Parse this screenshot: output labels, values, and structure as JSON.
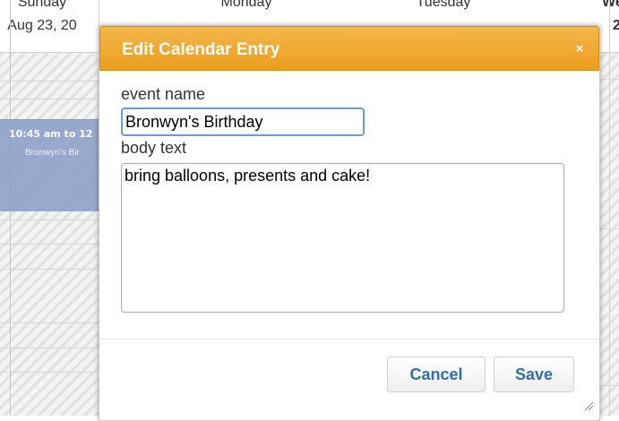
{
  "calendar": {
    "days": [
      {
        "name": "Sunday",
        "date": "Aug 23, 20"
      },
      {
        "name": "Monday",
        "date": ""
      },
      {
        "name": "Tuesday",
        "date": ""
      },
      {
        "name": "Wedn",
        "date": "2"
      }
    ],
    "event": {
      "time": "10:45 am to 12",
      "title": "Bronwyn's Bir"
    }
  },
  "dialog": {
    "title": "Edit Calendar Entry",
    "close_icon": "×",
    "event_name_label": "event name",
    "event_name_value": "Bronwyn's Birthday",
    "body_label": "body text",
    "body_value": "bring balloons, presents and cake!",
    "cancel_label": "Cancel",
    "save_label": "Save",
    "colors": {
      "titlebar": "#ec9d1f",
      "button_text": "#2f6fad",
      "input_focus_border": "#6b9ad6"
    }
  }
}
